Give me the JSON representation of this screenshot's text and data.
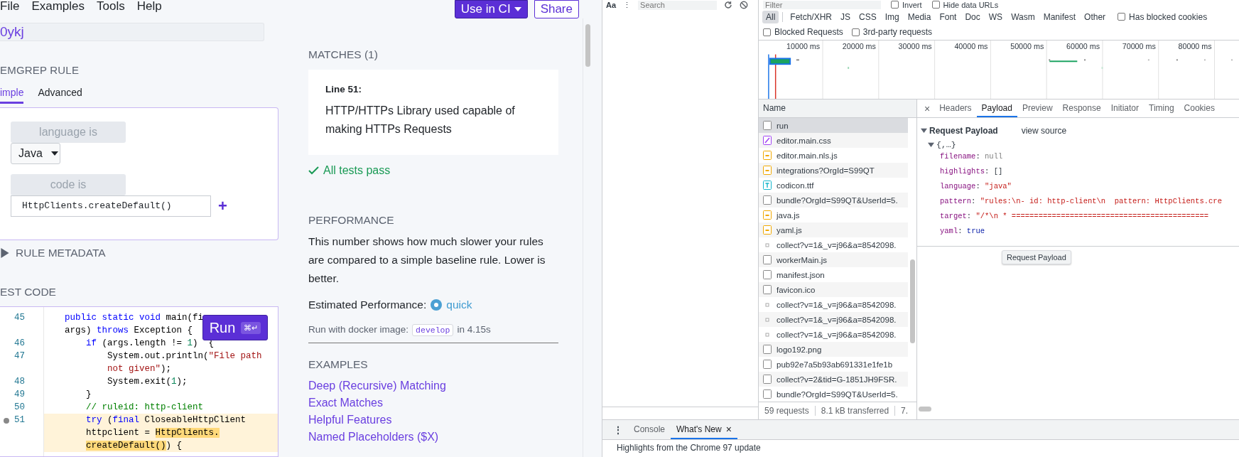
{
  "app": {
    "menu": [
      "File",
      "Examples",
      "Tools",
      "Help"
    ],
    "rule_name": "0ykj",
    "header_buttons": [
      {
        "label": "Use in CI",
        "kind": "primary"
      },
      {
        "label": "Share",
        "kind": "outline"
      }
    ],
    "rule_section": {
      "title": "EMGREP RULE",
      "tabs": [
        {
          "label": "imple",
          "selected": true
        },
        {
          "label": "Advanced",
          "selected": false
        }
      ],
      "language_label": "language is",
      "language": "Java",
      "code_label": "code is",
      "code_value": "HttpClients.createDefault()",
      "add": "+"
    },
    "metadata": {
      "title": "RULE METADATA",
      "expanded": false
    },
    "test_code": {
      "title": "EST CODE",
      "run_button": {
        "label": "Run",
        "shortcut": "⌘↵"
      },
      "lines": [
        {
          "number": "45",
          "marker": false,
          "highlight": false,
          "tokens": [
            {
              "text": "    public static void",
              "kind": "keyword"
            },
            {
              "text": " main(fi",
              "kind": "plain"
            }
          ]
        },
        {
          "marker": false,
          "highlight": false,
          "tokens": [
            {
              "text": "    args) ",
              "kind": "plain"
            },
            {
              "text": "throws",
              "kind": "keyword"
            },
            {
              "text": " Exception {",
              "kind": "plain"
            }
          ]
        },
        {
          "number": "46",
          "marker": false,
          "highlight": false,
          "tokens": [
            {
              "text": "        if",
              "kind": "keyword"
            },
            {
              "text": " (args.length != ",
              "kind": "plain"
            },
            {
              "text": "1",
              "kind": "number"
            },
            {
              "text": ")  {",
              "kind": "plain"
            }
          ]
        },
        {
          "number": "47",
          "marker": false,
          "highlight": false,
          "tokens": [
            {
              "text": "            System.out.println(",
              "kind": "plain"
            },
            {
              "text": "\"File path",
              "kind": "string"
            }
          ]
        },
        {
          "marker": false,
          "highlight": false,
          "tokens": [
            {
              "text": "            not given\"",
              "kind": "string"
            },
            {
              "text": ");",
              "kind": "plain"
            }
          ]
        },
        {
          "number": "48",
          "marker": false,
          "highlight": false,
          "tokens": [
            {
              "text": "            System.exit(",
              "kind": "plain"
            },
            {
              "text": "1",
              "kind": "number"
            },
            {
              "text": ");",
              "kind": "plain"
            }
          ]
        },
        {
          "number": "49",
          "marker": false,
          "highlight": false,
          "tokens": [
            {
              "text": "        }",
              "kind": "plain"
            }
          ]
        },
        {
          "number": "50",
          "marker": false,
          "highlight": false,
          "tokens": [
            {
              "text": "        // ruleid: http-client",
              "kind": "comment"
            }
          ]
        },
        {
          "number": "51",
          "marker": true,
          "highlight": true,
          "tokens": [
            {
              "text": "        try",
              "kind": "keyword"
            },
            {
              "text": " (",
              "kind": "plain"
            },
            {
              "text": "final",
              "kind": "keyword"
            },
            {
              "text": " CloseableHttpClient",
              "kind": "plain"
            }
          ]
        },
        {
          "marker": false,
          "highlight": true,
          "tokens": [
            {
              "text": "        httpclient = ",
              "kind": "plain"
            },
            {
              "text": "HttpClients.",
              "kind": "match"
            }
          ]
        },
        {
          "marker": false,
          "highlight": true,
          "tokens": [
            {
              "text": "        createDefault()",
              "kind": "match"
            },
            {
              "text": ") {",
              "kind": "plain"
            }
          ]
        }
      ]
    },
    "matches": {
      "title": "MATCHES (1)",
      "items": [
        {
          "line": "Line 51:",
          "message": "HTTP/HTTPs Library used capable of making HTTPs Requests"
        }
      ],
      "status": "All tests pass"
    },
    "performance": {
      "title": "PERFORMANCE",
      "description": "This number shows how much slower your rules are compared to a simple baseline rule. Lower is better.",
      "estimate_label": "Estimated Performance:",
      "estimate": "quick",
      "run_prefix": "Run with docker image:",
      "image": "develop",
      "run_suffix": "in 4.15s"
    },
    "examples": {
      "title": "EXAMPLES",
      "links": [
        "Deep (Recursive) Matching",
        "Exact Matches",
        "Helpful Features",
        "Named Placeholders ($X)"
      ]
    }
  },
  "devtools": {
    "search_pane": {
      "case_toggle": "Aa",
      "more": "⋮",
      "search_placeholder": "Search"
    },
    "filter": {
      "placeholder": "Filter",
      "options": [
        {
          "label": "Invert",
          "checked": false
        },
        {
          "label": "Hide data URLs",
          "checked": false
        }
      ]
    },
    "types": [
      {
        "label": "All",
        "selected": true
      },
      {
        "label": "Fetch/XHR",
        "selected": false
      },
      {
        "label": "JS",
        "selected": false
      },
      {
        "label": "CSS",
        "selected": false
      },
      {
        "label": "Img",
        "selected": false
      },
      {
        "label": "Media",
        "selected": false
      },
      {
        "label": "Font",
        "selected": false
      },
      {
        "label": "Doc",
        "selected": false
      },
      {
        "label": "WS",
        "selected": false
      },
      {
        "label": "Wasm",
        "selected": false
      },
      {
        "label": "Manifest",
        "selected": false
      },
      {
        "label": "Other",
        "selected": false
      }
    ],
    "type_options": [
      {
        "label": "Has blocked cookies",
        "checked": false
      }
    ],
    "request_options": [
      {
        "label": "Blocked Requests",
        "checked": false
      },
      {
        "label": "3rd-party requests",
        "checked": false
      }
    ],
    "timeline": {
      "ticks": [
        "10000 ms",
        "20000 ms",
        "30000 ms",
        "40000 ms",
        "50000 ms",
        "60000 ms",
        "70000 ms",
        "80000 ms"
      ]
    },
    "requests": {
      "column": "Name",
      "rows": [
        {
          "name": "run",
          "kind": "doc",
          "selected": true
        },
        {
          "name": "editor.main.css",
          "kind": "css",
          "selected": false
        },
        {
          "name": "editor.main.nls.js",
          "kind": "script",
          "selected": false
        },
        {
          "name": "integrations?OrgId=S99QT",
          "kind": "script",
          "selected": false
        },
        {
          "name": "codicon.ttf",
          "kind": "font",
          "selected": false
        },
        {
          "name": "bundle?OrgId=S99QT&UserId=5.",
          "kind": "doc",
          "selected": false
        },
        {
          "name": "java.js",
          "kind": "script",
          "selected": false
        },
        {
          "name": "yaml.js",
          "kind": "script",
          "selected": false
        },
        {
          "name": "collect?v=1&_v=j96&a=8542098.",
          "kind": "dot",
          "selected": false
        },
        {
          "name": "workerMain.js",
          "kind": "doc",
          "selected": false
        },
        {
          "name": "manifest.json",
          "kind": "doc",
          "selected": false
        },
        {
          "name": "favicon.ico",
          "kind": "doc",
          "selected": false
        },
        {
          "name": "collect?v=1&_v=j96&a=8542098.",
          "kind": "dot",
          "selected": false
        },
        {
          "name": "collect?v=1&_v=j96&a=8542098.",
          "kind": "dot",
          "selected": false
        },
        {
          "name": "collect?v=1&_v=j96&a=8542098.",
          "kind": "dot",
          "selected": false
        },
        {
          "name": "logo192.png",
          "kind": "doc",
          "selected": false
        },
        {
          "name": "pub92e7a5b93ab691331e1fe1b",
          "kind": "doc",
          "selected": false
        },
        {
          "name": "collect?v=2&tid=G-1851JH9FSR.",
          "kind": "doc",
          "selected": false
        },
        {
          "name": "bundle?OrgId=S99QT&UserId=5.",
          "kind": "doc",
          "selected": false
        }
      ]
    },
    "status": [
      "59 requests",
      "8.1 kB transferred",
      "7."
    ],
    "details": {
      "close": "×",
      "tabs": [
        {
          "label": "Headers",
          "selected": false
        },
        {
          "label": "Payload",
          "selected": true
        },
        {
          "label": "Preview",
          "selected": false
        },
        {
          "label": "Response",
          "selected": false
        },
        {
          "label": "Initiator",
          "selected": false
        },
        {
          "label": "Timing",
          "selected": false
        },
        {
          "label": "Cookies",
          "selected": false
        }
      ],
      "section": "Request Payload",
      "expanded": true,
      "view_source": "view source",
      "object": "{,…}",
      "fields": [
        {
          "text": "filename: null",
          "kind": "null"
        },
        {
          "text": "highlights: []",
          "kind": "plain"
        },
        {
          "text": "language: \"java\"",
          "kind": "string"
        },
        {
          "text": "pattern: \"rules:\\n- id: http-client\\n  pattern: HttpClients.cre",
          "kind": "string"
        },
        {
          "text": "target: \"/*\\n * ============================================",
          "kind": "string"
        },
        {
          "text": "yaml: true",
          "kind": "bool"
        }
      ],
      "tooltip": "Request Payload"
    },
    "drawer": {
      "more": "⋮",
      "tabs": [
        {
          "label": "Console",
          "selected": false
        },
        {
          "label": "What's New",
          "selected": true
        }
      ],
      "close": "×",
      "text": "Highlights from the Chrome 97 update"
    }
  }
}
